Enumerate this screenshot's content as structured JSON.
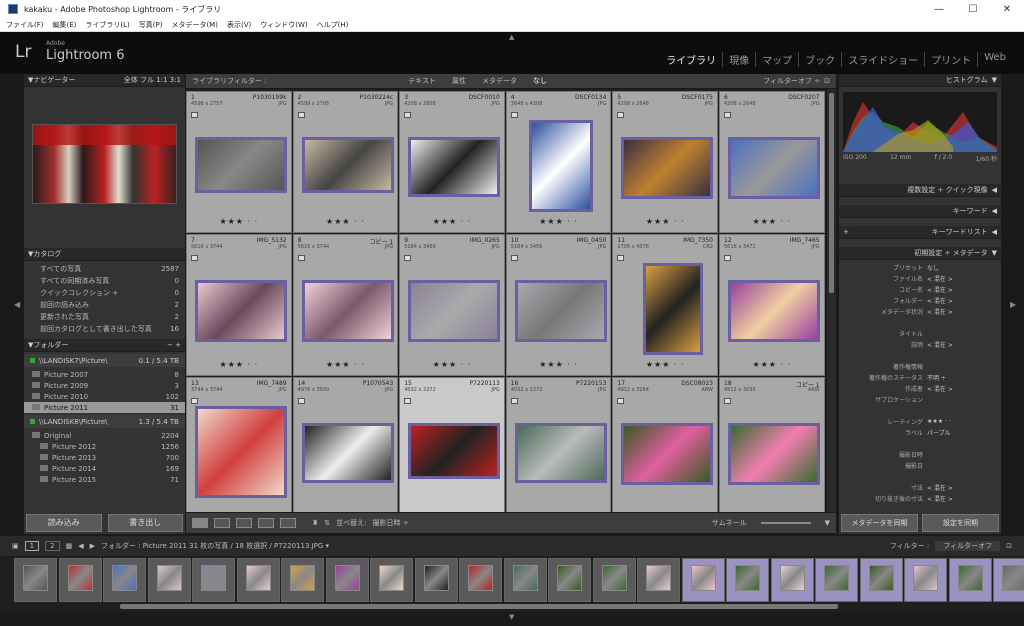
{
  "window": {
    "title": "kakaku - Adobe Photoshop Lightroom - ライブラリ",
    "minimize": "—",
    "maximize": "☐",
    "close": "✕"
  },
  "menu": [
    "ファイル(F)",
    "編集(E)",
    "ライブラリ(L)",
    "写真(P)",
    "メタデータ(M)",
    "表示(V)",
    "ウィンドウ(W)",
    "ヘルプ(H)"
  ],
  "identity": {
    "logo": "Lr",
    "adobe": "Adobe",
    "product": "Lightroom 6"
  },
  "modules": [
    "ライブラリ",
    "現像",
    "マップ",
    "ブック",
    "スライドショー",
    "プリント",
    "Web"
  ],
  "navigator": {
    "title": "ナビゲーター",
    "modes": "全体  フル  1:1  3:1"
  },
  "catalog": {
    "title": "カタログ",
    "items": [
      {
        "label": "すべての写真",
        "count": "2587"
      },
      {
        "label": "すべての同期済み写真",
        "count": "0"
      },
      {
        "label": "クイックコレクション  +",
        "count": "0"
      },
      {
        "label": "前回の読み込み",
        "count": "2"
      },
      {
        "label": "更新された写真",
        "count": "2"
      },
      {
        "label": "前回カタログとして書き出した写真",
        "count": "16"
      }
    ]
  },
  "folders": {
    "title": "フォルダー",
    "volumes": [
      {
        "name": "\\\\LANDISK7\\Picture\\",
        "size": "0.1 / 5.4 TB"
      },
      {
        "name": "\\\\LANDISK8\\Picture\\",
        "size": "1.3 / 5.4 TB"
      }
    ],
    "list1": [
      {
        "name": "Picture 2007",
        "count": "8"
      },
      {
        "name": "Picture 2009",
        "count": "3"
      },
      {
        "name": "Picture 2010",
        "count": "102"
      },
      {
        "name": "Picture 2011",
        "count": "31"
      }
    ],
    "list2": [
      {
        "name": "Original",
        "count": "2204"
      },
      {
        "name": "Picture 2012",
        "count": "1256"
      },
      {
        "name": "Picture 2013",
        "count": "700"
      },
      {
        "name": "Picture 2014",
        "count": "169"
      },
      {
        "name": "Picture 2015",
        "count": "71"
      }
    ]
  },
  "left_buttons": {
    "import": "読み込み",
    "export": "書き出し"
  },
  "filter": {
    "title": "ライブラリフィルター :",
    "text": "テキスト",
    "attr": "属性",
    "meta": "メタデータ",
    "none": "なし",
    "off": "フィルターオフ ÷"
  },
  "grid": [
    {
      "num": "1",
      "fn": "P1030199k",
      "dim": "4596 x 2757",
      "ext": "JPG",
      "stars": "★★★ · ·"
    },
    {
      "num": "2",
      "fn": "P1030224c",
      "dim": "4599 x 2795",
      "ext": "JPG",
      "stars": "★★★ · ·"
    },
    {
      "num": "3",
      "fn": "DSCF0010",
      "dim": "4208 x 2608",
      "ext": "JPG",
      "stars": "★★★ · ·"
    },
    {
      "num": "4",
      "fn": "DSCF0134",
      "dim": "3648 x 4208",
      "ext": "JPG",
      "stars": "★★★ · ·"
    },
    {
      "num": "5",
      "fn": "DSCF0175",
      "dim": "4208 x 2648",
      "ext": "JPG",
      "stars": "★★★ · ·"
    },
    {
      "num": "6",
      "fn": "DSCF0207",
      "dim": "4208 x 2648",
      "ext": "JPG",
      "stars": "★★★ · ·"
    },
    {
      "num": "7",
      "fn": "IMG_5132",
      "dim": "5616 x 3744",
      "ext": "JPG",
      "stars": "★★★ · ·"
    },
    {
      "num": "8",
      "fn": "コピー 1",
      "dim": "5616 x 3744",
      "ext": "JPG",
      "stars": "★★★ · ·"
    },
    {
      "num": "9",
      "fn": "IMG_0265",
      "dim": "5184 x 3456",
      "ext": "JPG",
      "stars": "★★★ · ·"
    },
    {
      "num": "10",
      "fn": "IMG_0450",
      "dim": "5184 x 3456",
      "ext": "JPG",
      "stars": "★★★ · ·"
    },
    {
      "num": "11",
      "fn": "IMG_7350",
      "dim": "2705 x 4376",
      "ext": "CR2",
      "stars": "★★★ · ·"
    },
    {
      "num": "12",
      "fn": "IMG_7465",
      "dim": "5616 x 3471",
      "ext": "JPG",
      "stars": "★★★ · ·"
    },
    {
      "num": "13",
      "fn": "IMG_7489",
      "dim": "3744 x 3744",
      "ext": "JPG",
      "stars": ""
    },
    {
      "num": "14",
      "fn": "P1070543",
      "dim": "4976 x 3500",
      "ext": "JPG",
      "stars": ""
    },
    {
      "num": "15",
      "fn": "P7220113",
      "dim": "4032 x 2272",
      "ext": "JPG",
      "stars": ""
    },
    {
      "num": "16",
      "fn": "P7220153",
      "dim": "4032 x 2272",
      "ext": "JPG",
      "stars": ""
    },
    {
      "num": "17",
      "fn": "DSC08023",
      "dim": "4912 x 3264",
      "ext": "ARW",
      "stars": ""
    },
    {
      "num": "18",
      "fn": "コピー 1",
      "dim": "4912 x 3035",
      "ext": "ARW",
      "stars": ""
    }
  ],
  "toolbar": {
    "sort_label": "並べ替え:",
    "sort_value": "撮影日時 ÷",
    "thumb": "サムネール"
  },
  "histogram": {
    "title": "ヒストグラム",
    "iso": "ISO 200",
    "focal": "12 mm",
    "aperture": "f / 2.0",
    "shutter": "1/60 秒",
    "panels": [
      "複数設定 ÷    クイック現像",
      "キーワード",
      "キーワードリスト",
      "初期設定 ÷    メタデータ"
    ],
    "colors": [
      "#c03030",
      "#3a9a3a",
      "#3a5ad0",
      "#c0a020"
    ]
  },
  "metadata": [
    {
      "k": "プリセット",
      "v": "なし"
    },
    {
      "k": "ファイル名",
      "v": "< 混在 >"
    },
    {
      "k": "コピー名",
      "v": "< 混在 >"
    },
    {
      "k": "フォルダー",
      "v": "< 混在 >"
    },
    {
      "k": "メタデータ状況",
      "v": "< 混在 >"
    },
    {
      "k": "",
      "v": ""
    },
    {
      "k": "タイトル",
      "v": ""
    },
    {
      "k": "説明",
      "v": "< 混在 >"
    },
    {
      "k": "",
      "v": ""
    },
    {
      "k": "著作権情報",
      "v": ""
    },
    {
      "k": "著作権のステータス",
      "v": "不明 ÷"
    },
    {
      "k": "作成者",
      "v": "< 混在 >"
    },
    {
      "k": "サブロケーション",
      "v": ""
    },
    {
      "k": "",
      "v": ""
    },
    {
      "k": "レーティング",
      "v": "★★★ · ·"
    },
    {
      "k": "ラベル",
      "v": "パープル"
    },
    {
      "k": "",
      "v": ""
    },
    {
      "k": "撮影日時",
      "v": ""
    },
    {
      "k": "撮影日",
      "v": ""
    },
    {
      "k": "",
      "v": ""
    },
    {
      "k": "寸法",
      "v": "< 混在 >"
    },
    {
      "k": "切り抜き後の寸法",
      "v": "< 混在 >"
    }
  ],
  "right_buttons": {
    "sync_meta": "メタデータを同期",
    "sync_settings": "設定を同期"
  },
  "filmbar": {
    "p1": "1",
    "p2": "2",
    "path": "フォルダー : Picture 2011   31 枚の写真 / 18 枚選択 / P7220113.JPG ▾",
    "filter": "フィルター :",
    "filter_value": "フィルターオフ"
  }
}
